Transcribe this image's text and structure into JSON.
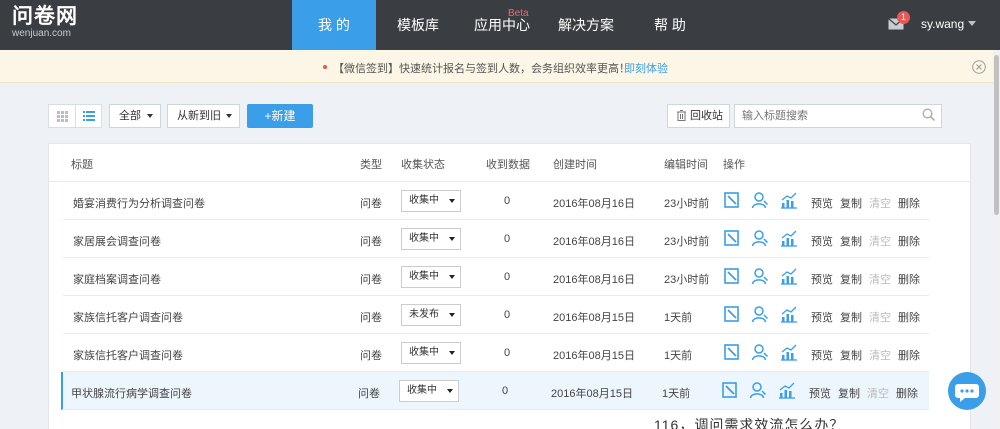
{
  "header": {
    "logo_cn": "问卷网",
    "logo_en": "wenjuan.com",
    "nav": [
      {
        "label": "我 的",
        "active": true
      },
      {
        "label": "模板库",
        "active": false
      },
      {
        "label": "应用中心",
        "active": false,
        "tag": "Beta"
      },
      {
        "label": "解决方案",
        "active": false
      },
      {
        "label": "帮 助",
        "active": false
      }
    ],
    "unread_count": "1",
    "username": "sy.wang"
  },
  "notice": {
    "text": "【微信签到】快速统计报名与签到人数，会务组织效率更高！",
    "link": "即刻体验"
  },
  "toolbar": {
    "filter_value": "全部",
    "sort_value": "从新到旧",
    "new_label": "+新建",
    "recycle_label": "回收站",
    "search_placeholder": "输入标题搜索"
  },
  "table": {
    "headers": {
      "title": "标题",
      "type": "类型",
      "status": "收集状态",
      "received": "收到数据",
      "created": "创建时间",
      "edited": "编辑时间",
      "ops": "操作"
    },
    "actions": {
      "preview": "预览",
      "copy": "复制",
      "clear": "清空",
      "delete": "删除"
    },
    "rows": [
      {
        "title": "婚宴消费行为分析调查问卷",
        "type": "问卷",
        "status": "收集中",
        "received": "0",
        "created": "2016年08月16日",
        "edited": "23小时前"
      },
      {
        "title": "家居展会调查问卷",
        "type": "问卷",
        "status": "收集中",
        "received": "0",
        "created": "2016年08月16日",
        "edited": "23小时前"
      },
      {
        "title": "家庭档案调查问卷",
        "type": "问卷",
        "status": "收集中",
        "received": "0",
        "created": "2016年08月16日",
        "edited": "23小时前"
      },
      {
        "title": "家族信托客户调查问卷",
        "type": "问卷",
        "status": "未发布",
        "received": "0",
        "created": "2016年08月15日",
        "edited": "1天前"
      },
      {
        "title": "家族信托客户调查问卷",
        "type": "问卷",
        "status": "收集中",
        "received": "0",
        "created": "2016年08月15日",
        "edited": "1天前"
      },
      {
        "title": "甲状腺流行病学调查问卷",
        "type": "问卷",
        "status": "收集中",
        "received": "0",
        "created": "2016年08月15日",
        "edited": "1天前"
      }
    ]
  },
  "bottom_text": "116，调问需求效流怎么办？",
  "colors": {
    "accent": "#3a9ee8",
    "topbar": "#3a3e42",
    "notice_bg": "#fbf6e5"
  }
}
